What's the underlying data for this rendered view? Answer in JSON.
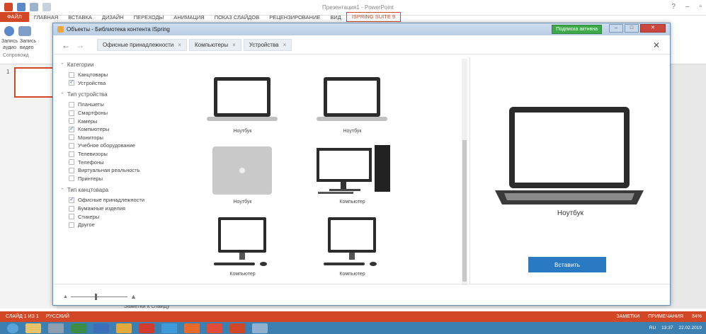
{
  "powerpoint": {
    "app_title": "Презентация1 - PowerPoint",
    "tabs": [
      "ФАЙЛ",
      "ГЛАВНАЯ",
      "ВСТАВКА",
      "ДИЗАЙН",
      "ПЕРЕХОДЫ",
      "АНИМАЦИЯ",
      "ПОКАЗ СЛАЙДОВ",
      "РЕЦЕНЗИРОВАНИЕ",
      "ВИД",
      "ISPRING SUITE 9"
    ],
    "ribbon": {
      "record_label": "Запись",
      "record_audio": "аудио",
      "record_video": "видео",
      "accompaniment": "Сопровожд"
    },
    "thumb_number": "1",
    "notes_placeholder": "Заметки к слайду",
    "status": {
      "slide": "СЛАЙД 1 ИЗ 1",
      "lang": "РУССКИЙ",
      "notes": "ЗАМЕТКИ",
      "comments": "ПРИМЕЧАНИЯ",
      "zoom": "84%"
    },
    "tray": {
      "lang": "RU",
      "time": "13:37",
      "date": "22.02.2019"
    }
  },
  "dialog": {
    "title": "Объекты - Библиотека контента iSpring",
    "subscription_badge": "Подписка активна",
    "win_buttons": [
      "–",
      "□",
      "✕"
    ],
    "breadcrumbs": [
      {
        "label": "Офисные принадлежности"
      },
      {
        "label": "Компьютеры"
      },
      {
        "label": "Устройства"
      }
    ],
    "filters": [
      {
        "title": "Категории",
        "options": [
          {
            "label": "Канцтовары",
            "checked": false
          },
          {
            "label": "Устройства",
            "checked": true
          }
        ]
      },
      {
        "title": "Тип устройства",
        "options": [
          {
            "label": "Планшеты",
            "checked": false
          },
          {
            "label": "Смартфоны",
            "checked": false
          },
          {
            "label": "Камеры",
            "checked": false
          },
          {
            "label": "Компьютеры",
            "checked": true
          },
          {
            "label": "Мониторы",
            "checked": false
          },
          {
            "label": "Учебное оборудование",
            "checked": false
          },
          {
            "label": "Телевизоры",
            "checked": false
          },
          {
            "label": "Телефоны",
            "checked": false
          },
          {
            "label": "Виртуальная реальность",
            "checked": false
          },
          {
            "label": "Принтеры",
            "checked": false
          }
        ]
      },
      {
        "title": "Тип канцтовара",
        "options": [
          {
            "label": "Офисные принадлежности",
            "checked": true
          },
          {
            "label": "Бумажные изделия",
            "checked": false
          },
          {
            "label": "Стикеры",
            "checked": false
          },
          {
            "label": "Другое",
            "checked": false
          }
        ]
      }
    ],
    "items": [
      {
        "label": "Ноутбук",
        "kind": "laptop-partial"
      },
      {
        "label": "Ноутбук",
        "kind": "laptop-partial"
      },
      {
        "label": "Ноутбук",
        "kind": "laptop"
      },
      {
        "label": "Ноутбук",
        "kind": "laptop"
      },
      {
        "label": "Ноутбук",
        "kind": "laptop-closed"
      },
      {
        "label": "Компьютер",
        "kind": "desktop-tower"
      },
      {
        "label": "Компьютер",
        "kind": "all-in-one"
      },
      {
        "label": "Компьютер",
        "kind": "all-in-one"
      }
    ],
    "preview": {
      "name": "Ноутбук",
      "insert_label": "Вставить"
    },
    "colors": {
      "accent": "#2a7ac2",
      "brand": "#d24726",
      "badge": "#3fa84a"
    }
  }
}
